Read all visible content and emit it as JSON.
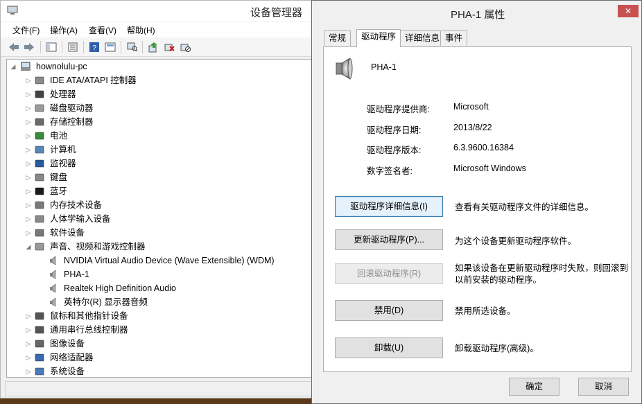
{
  "device_manager": {
    "title": "设备管理器",
    "menu": [
      "文件(F)",
      "操作(A)",
      "查看(V)",
      "帮助(H)"
    ],
    "tree": {
      "root": "hownolulu-pc",
      "categories": [
        {
          "label": "IDE ATA/ATAPI 控制器",
          "icon": "ide-controller-icon",
          "expanded": false
        },
        {
          "label": "处理器",
          "icon": "processor-icon",
          "expanded": false
        },
        {
          "label": "磁盘驱动器",
          "icon": "disk-drive-icon",
          "expanded": false
        },
        {
          "label": "存储控制器",
          "icon": "storage-controller-icon",
          "expanded": false
        },
        {
          "label": "电池",
          "icon": "battery-icon",
          "expanded": false
        },
        {
          "label": "计算机",
          "icon": "computer-icon",
          "expanded": false
        },
        {
          "label": "监视器",
          "icon": "monitor-icon",
          "expanded": false
        },
        {
          "label": "键盘",
          "icon": "keyboard-icon",
          "expanded": false
        },
        {
          "label": "蓝牙",
          "icon": "bluetooth-icon",
          "expanded": false
        },
        {
          "label": "内存技术设备",
          "icon": "memory-icon",
          "expanded": false
        },
        {
          "label": "人体学输入设备",
          "icon": "hid-icon",
          "expanded": false
        },
        {
          "label": "软件设备",
          "icon": "software-device-icon",
          "expanded": false
        },
        {
          "label": "声音、视频和游戏控制器",
          "icon": "sound-icon",
          "expanded": true,
          "children": [
            "NVIDIA Virtual Audio Device (Wave Extensible) (WDM)",
            "PHA-1",
            "Realtek High Definition Audio",
            "英特尔(R) 显示器音频"
          ]
        },
        {
          "label": "鼠标和其他指针设备",
          "icon": "mouse-icon",
          "expanded": false
        },
        {
          "label": "通用串行总线控制器",
          "icon": "usb-icon",
          "expanded": false
        },
        {
          "label": "图像设备",
          "icon": "camera-icon",
          "expanded": false
        },
        {
          "label": "网络适配器",
          "icon": "network-adapter-icon",
          "expanded": false
        },
        {
          "label": "系统设备",
          "icon": "system-device-icon",
          "expanded": false
        }
      ]
    }
  },
  "properties_dialog": {
    "title": "PHA-1 属性",
    "close_symbol": "✕",
    "tabs": [
      "常规",
      "驱动程序",
      "详细信息",
      "事件"
    ],
    "active_tab": "驱动程序",
    "device_name": "PHA-1",
    "properties": [
      {
        "label": "驱动程序提供商:",
        "value": "Microsoft"
      },
      {
        "label": "驱动程序日期:",
        "value": "2013/8/22"
      },
      {
        "label": "驱动程序版本:",
        "value": "6.3.9600.16384"
      },
      {
        "label": "数字签名者:",
        "value": "Microsoft Windows"
      }
    ],
    "buttons": [
      {
        "label": "驱动程序详细信息(I)",
        "desc": "查看有关驱动程序文件的详细信息。",
        "state": "focused"
      },
      {
        "label": "更新驱动程序(P)...",
        "desc": "为这个设备更新驱动程序软件。",
        "state": "normal"
      },
      {
        "label": "回滚驱动程序(R)",
        "desc": "如果该设备在更新驱动程序时失败，则回滚到以前安装的驱动程序。",
        "state": "disabled"
      },
      {
        "label": "禁用(D)",
        "desc": "禁用所选设备。",
        "state": "normal"
      },
      {
        "label": "卸载(U)",
        "desc": "卸载驱动程序(高级)。",
        "state": "normal"
      }
    ],
    "ok_label": "确定",
    "cancel_label": "取消"
  }
}
